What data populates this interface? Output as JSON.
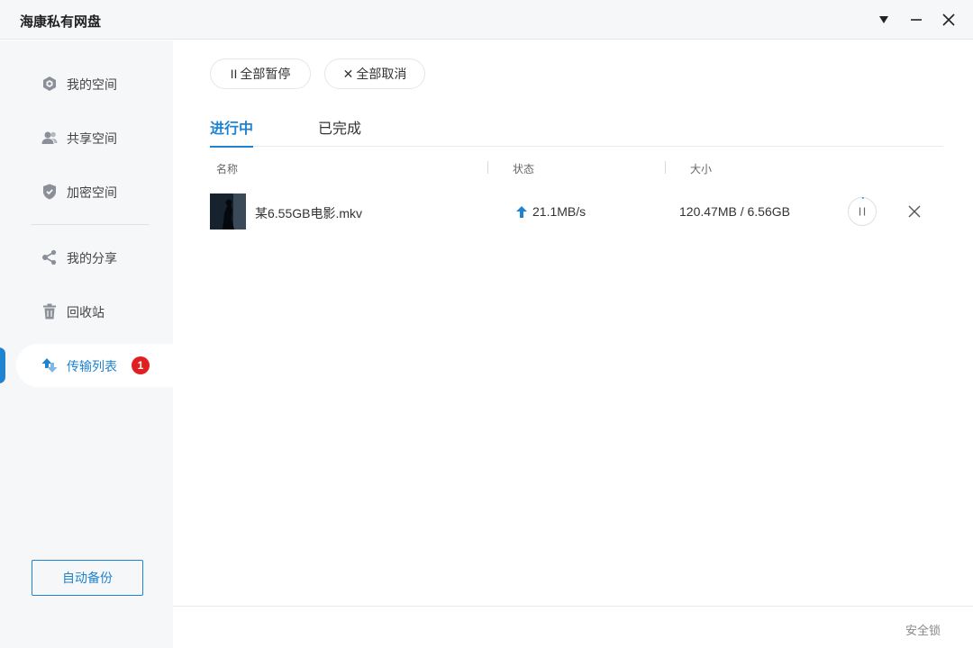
{
  "window": {
    "title": "海康私有网盘",
    "controls": {
      "menu_icon": "dropdown-triangle-icon",
      "minimize_icon": "minimize-icon",
      "close_icon": "close-icon"
    }
  },
  "sidebar": {
    "items": [
      {
        "label": "我的空间",
        "icon": "my-space-icon"
      },
      {
        "label": "共享空间",
        "icon": "shared-space-icon"
      },
      {
        "label": "加密空间",
        "icon": "encrypted-space-icon"
      },
      {
        "label": "我的分享",
        "icon": "share-icon"
      },
      {
        "label": "回收站",
        "icon": "recycle-bin-icon"
      },
      {
        "label": "传输列表",
        "icon": "transfer-icon",
        "active": true,
        "badge": "1"
      }
    ],
    "backup_button": "自动备份"
  },
  "toolbar": {
    "pause_all": {
      "glyph": "II",
      "label": "全部暂停"
    },
    "cancel_all": {
      "glyph": "✕",
      "label": "全部取消"
    }
  },
  "tabs": [
    {
      "label": "进行中",
      "active": true
    },
    {
      "label": "已完成",
      "active": false
    }
  ],
  "columns": [
    "名称",
    "状态",
    "大小"
  ],
  "transfers": [
    {
      "name": "某6.55GB电影.mkv",
      "direction": "upload",
      "speed": "21.1MB/s",
      "size": "120.47MB / 6.56GB",
      "progress": 0.018
    }
  ],
  "footer": {
    "text": "安全锁"
  },
  "colors": {
    "accent": "#1f83d0",
    "badge": "#e02020",
    "sidebar_bg": "#f6f7f9"
  }
}
